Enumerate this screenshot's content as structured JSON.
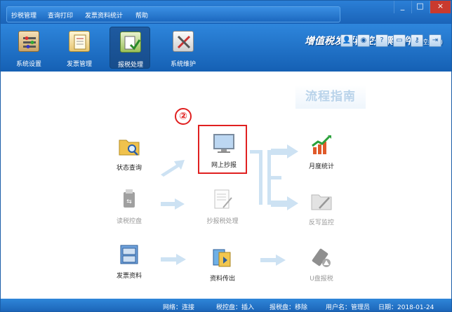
{
  "menu": {
    "items": [
      "抄税管理",
      "查询打印",
      "发票资料统计",
      "帮助"
    ]
  },
  "window_controls": {
    "minimize": "_",
    "maximize": "□",
    "close": "×"
  },
  "toolbar": {
    "tools": [
      {
        "label": "系统设置",
        "icon": "settings-icon"
      },
      {
        "label": "发票管理",
        "icon": "invoice-icon"
      },
      {
        "label": "报税处理",
        "icon": "tax-report-icon"
      },
      {
        "label": "系统维护",
        "icon": "maintenance-icon"
      }
    ],
    "active_index": 2
  },
  "app": {
    "title": "增值税发票税控开票软件",
    "subtitle": "(税控盘版)"
  },
  "guide": {
    "title": "流程指南",
    "step_badge": "②"
  },
  "nodes": {
    "status_query": {
      "label": "状态查询",
      "icon": "folder-search-icon"
    },
    "read_disk": {
      "label": "读税控盘",
      "icon": "usb-icon"
    },
    "invoice_data": {
      "label": "发票资料",
      "icon": "cabinet-icon"
    },
    "online_report": {
      "label": "网上抄报",
      "icon": "monitor-icon"
    },
    "report_process": {
      "label": "抄报税处理",
      "icon": "document-icon"
    },
    "data_export": {
      "label": "资料传出",
      "icon": "export-icon"
    },
    "monthly_stats": {
      "label": "月度统计",
      "icon": "chart-icon"
    },
    "feedback_monitor": {
      "label": "反写监控",
      "icon": "folder-edit-icon"
    },
    "u_disk_report": {
      "label": "U盘报税",
      "icon": "usb-drive-icon"
    }
  },
  "status": {
    "network": "网络：连接",
    "tax_disk": "税控盘：插入",
    "report_disk": "报税盘：移除",
    "username": "用户名：管理员",
    "date": "日期：2018-01-24"
  },
  "colors": {
    "accent": "#1a63b8",
    "highlight_red": "#e02020",
    "arrow": "#cde2f3"
  }
}
